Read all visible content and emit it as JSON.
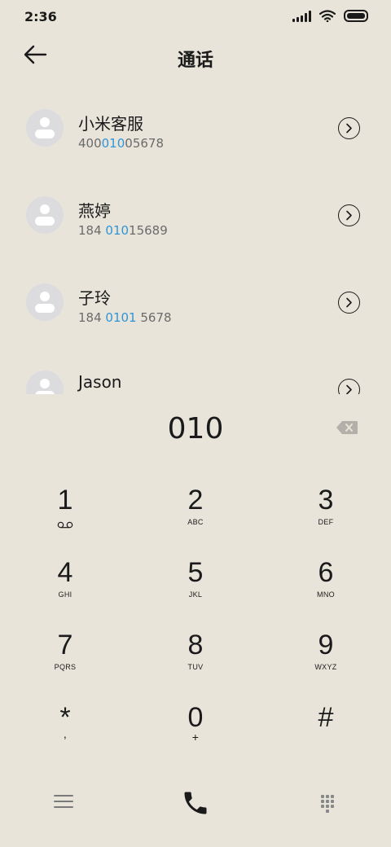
{
  "status_bar": {
    "time": "2:36"
  },
  "header": {
    "title": "通话",
    "back_icon": "arrow-left-icon"
  },
  "contacts": [
    {
      "name": "小米客服",
      "number_pre": "400",
      "number_hl": "010",
      "number_post": "05678"
    },
    {
      "name": "燕婷",
      "number_pre": "184 ",
      "number_hl": "010",
      "number_post": "15689"
    },
    {
      "name": "子玲",
      "number_pre": "184 ",
      "number_hl": "0101",
      "number_post": " 5678"
    },
    {
      "name": "Jason",
      "number_pre": "",
      "number_hl": "",
      "number_post": ""
    }
  ],
  "dial": {
    "input": "010"
  },
  "keypad": [
    {
      "digit": "1",
      "letters": ""
    },
    {
      "digit": "2",
      "letters": "ABC"
    },
    {
      "digit": "3",
      "letters": "DEF"
    },
    {
      "digit": "4",
      "letters": "GHI"
    },
    {
      "digit": "5",
      "letters": "JKL"
    },
    {
      "digit": "6",
      "letters": "MNO"
    },
    {
      "digit": "7",
      "letters": "PQRS"
    },
    {
      "digit": "8",
      "letters": "TUV"
    },
    {
      "digit": "9",
      "letters": "WXYZ"
    },
    {
      "digit": "*",
      "letters": ","
    },
    {
      "digit": "0",
      "letters": "+"
    },
    {
      "digit": "#",
      "letters": ""
    }
  ],
  "colors": {
    "background": "#e8e4da",
    "highlight": "#2f95d8",
    "text": "#1a1a1a"
  }
}
